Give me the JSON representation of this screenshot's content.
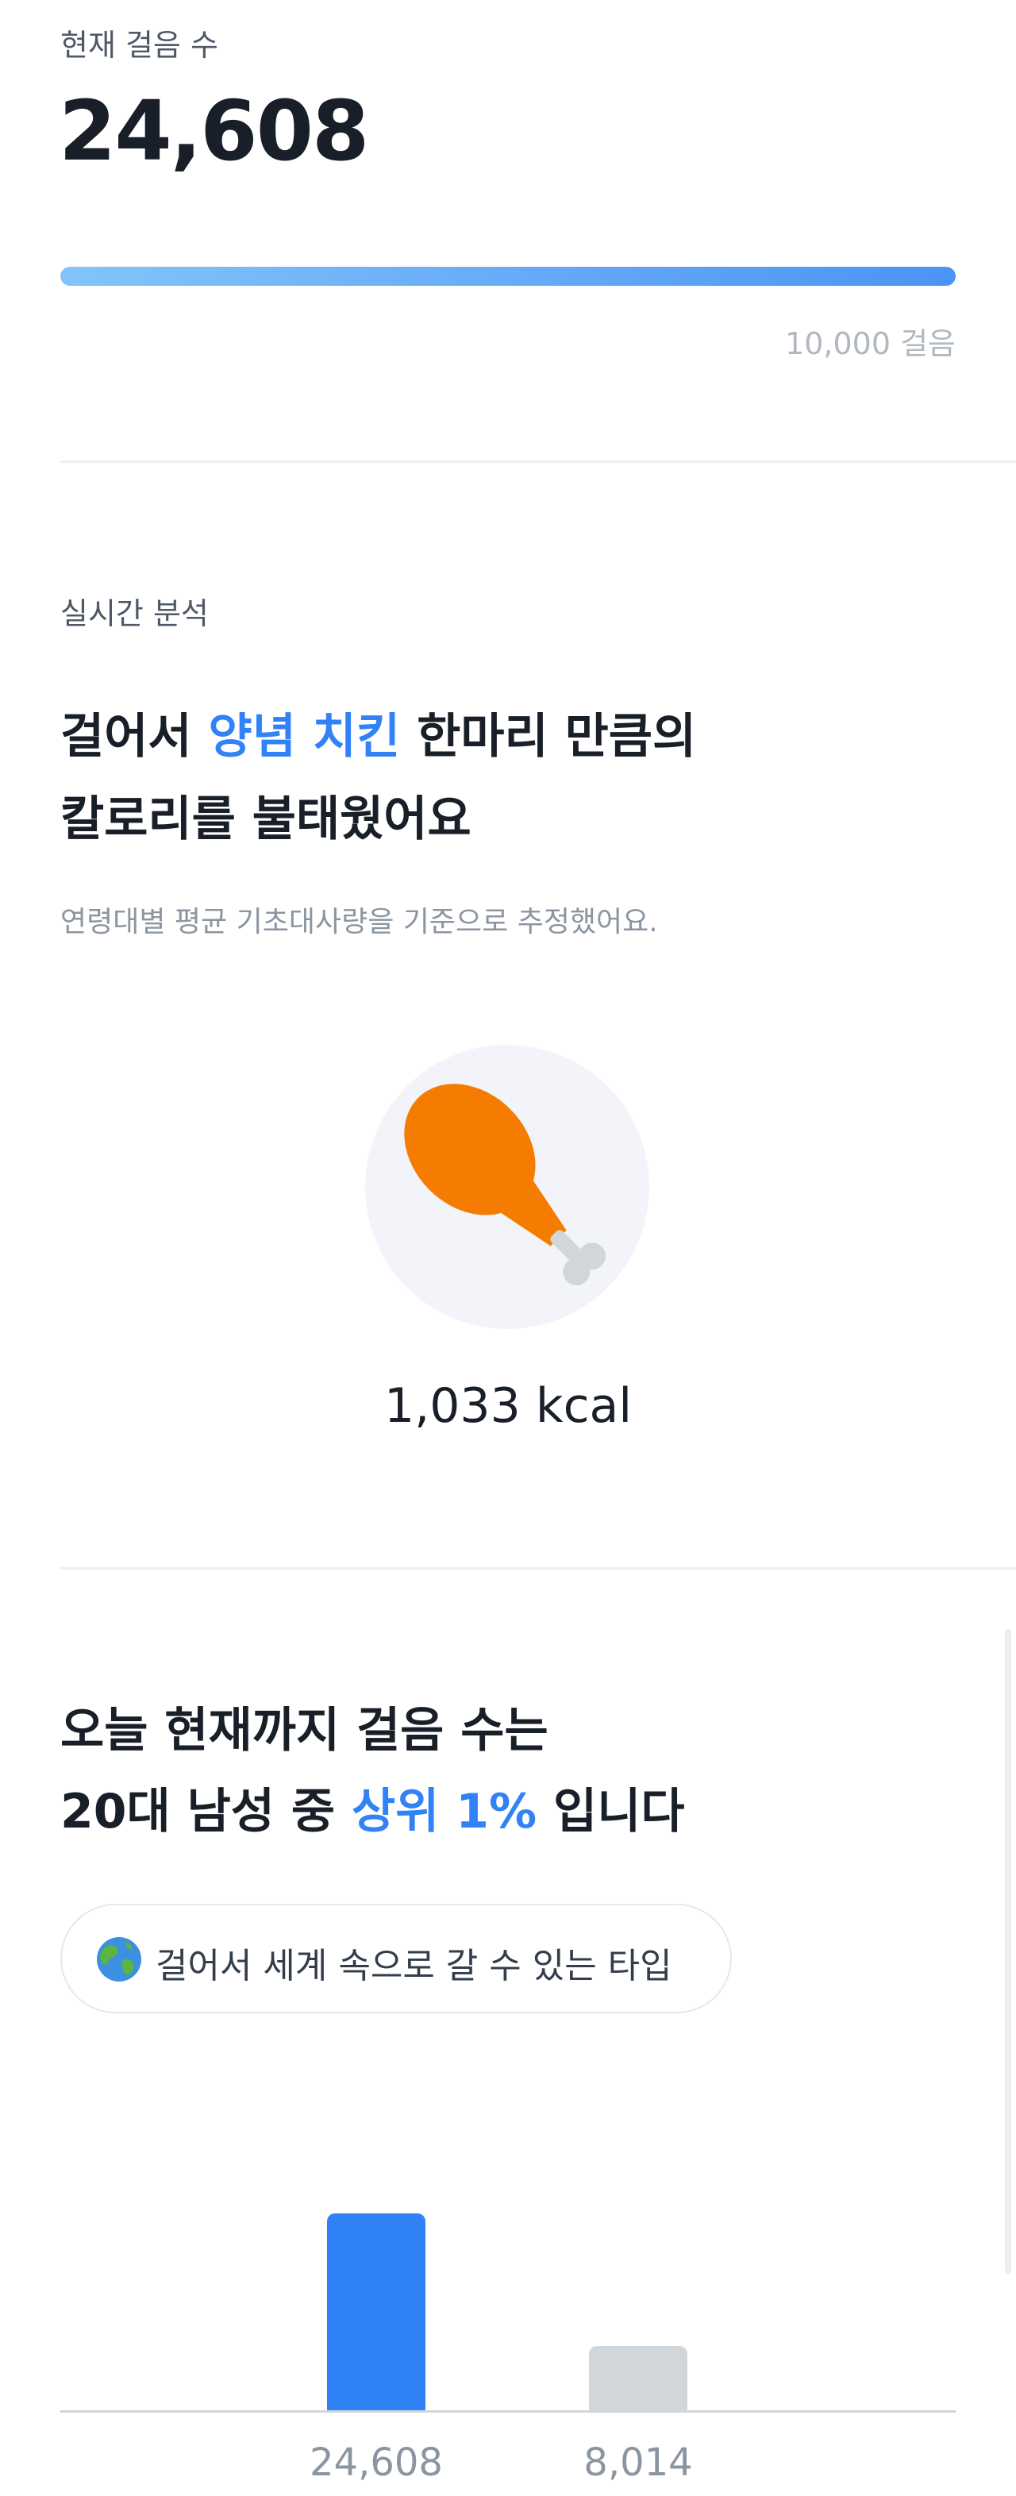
{
  "steps": {
    "label": "현재 걸음 수",
    "value": "24,608",
    "goal_label": "10,000 걸음",
    "progress_fraction": 1.0
  },
  "analysis": {
    "section_label": "실시간 분석",
    "headline_line1_prefix": "걸어서 ",
    "headline_line1_accent": "양념 치킨",
    "headline_line1_suffix": " 한마리 만큼의",
    "headline_line2": "칼로리를 불태웠어요",
    "note": "연령대별 평균 기초대사량을 기준으로 추정했어요.",
    "food_icon": "chicken-drumstick-icon",
    "kcal": "1,033 kcal"
  },
  "ranking": {
    "headline_line1": "오늘 현재까지 걸음 수는",
    "headline_line2_prefix": "20대 남성 중 ",
    "headline_line2_accent": "상위 1%",
    "headline_line2_suffix": " 입니다",
    "chip_icon": "globe-icon",
    "chip_label": "걸어서 세계 속으로 갈 수 있는 타입"
  },
  "colors": {
    "accent": "#3182f6",
    "bar_primary": "#3182f6",
    "bar_secondary": "#d1d6db",
    "food": "#f57c00"
  },
  "chart_data": {
    "type": "bar",
    "categories": [
      "24,608",
      "8,014"
    ],
    "values": [
      24608,
      8014
    ],
    "ylim": [
      0,
      24608
    ],
    "grid": false
  }
}
